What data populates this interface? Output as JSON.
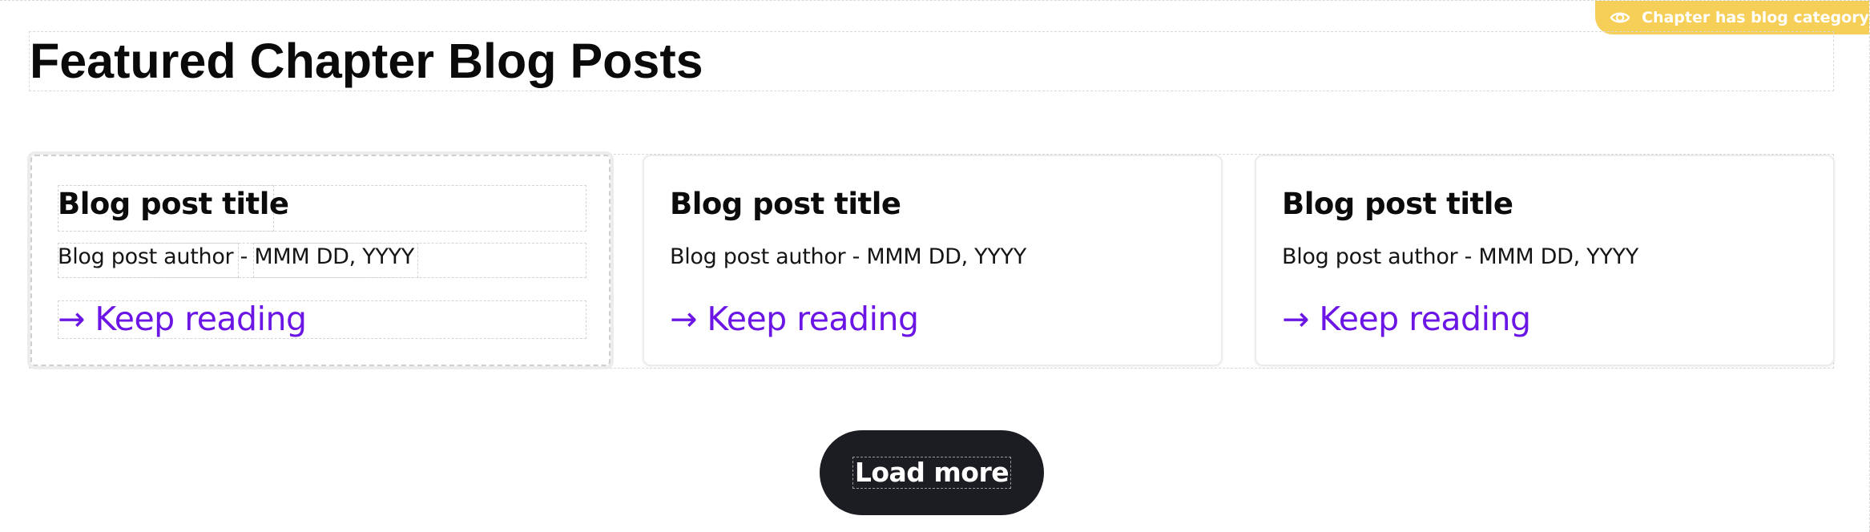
{
  "badge": {
    "label": "Chapter has blog category",
    "icon": "eye-icon",
    "color": "#f5cf58"
  },
  "section": {
    "heading": "Featured Chapter Blog Posts"
  },
  "posts": [
    {
      "title": "Blog post title",
      "author": "Blog post author",
      "separator": "-",
      "date": "MMM DD, YYYY",
      "link": "→ Keep reading"
    },
    {
      "title": "Blog post title",
      "meta": "Blog post author - MMM DD, YYYY",
      "link": "→ Keep reading"
    },
    {
      "title": "Blog post title",
      "meta": "Blog post author - MMM DD, YYYY",
      "link": "→ Keep reading"
    }
  ],
  "load_more": {
    "label": "Load more",
    "bg_color": "#1c1d22"
  },
  "colors": {
    "link": "#6b16e5",
    "text": "#111111"
  }
}
